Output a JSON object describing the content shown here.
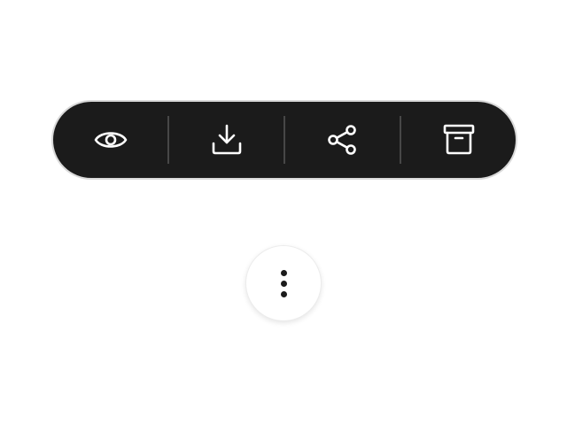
{
  "toolbar": {
    "background": "#1b1b1b",
    "icon_color": "#ffffff",
    "actions": [
      {
        "id": "view",
        "icon": "eye-icon"
      },
      {
        "id": "download",
        "icon": "download-icon"
      },
      {
        "id": "share",
        "icon": "share-icon"
      },
      {
        "id": "archive",
        "icon": "archive-icon"
      }
    ]
  },
  "more_button": {
    "icon": "more-vertical-icon"
  }
}
